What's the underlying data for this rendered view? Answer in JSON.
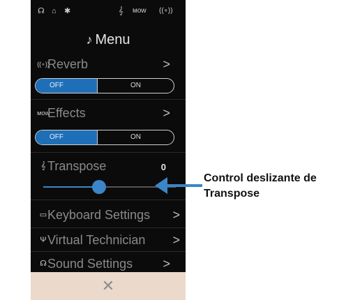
{
  "status_bar": {
    "icons": [
      "headphones-icon",
      "usb-drive-icon",
      "bluetooth-icon",
      "transpose-icon",
      "effects-icon",
      "reverb-icon"
    ],
    "headphones": "☊",
    "usb": "⌂",
    "bluetooth": "✱",
    "transpose": "𝄞",
    "effects": "ᴍᴏᴡ",
    "reverb": "((∘))"
  },
  "menu": {
    "title": "Menu",
    "title_icon": "♪"
  },
  "reverb": {
    "icon": "((∘))",
    "label": "Reverb",
    "chevron": ">",
    "toggle": {
      "off": "OFF",
      "on": "ON",
      "selected": "OFF"
    }
  },
  "effects": {
    "icon": "ᴍᴏᴡ",
    "label": "Effects",
    "chevron": ">",
    "toggle": {
      "off": "OFF",
      "on": "ON",
      "selected": "OFF"
    }
  },
  "transpose": {
    "icon": "𝄞",
    "label": "Transpose",
    "value": "0",
    "slider_position": 0.5
  },
  "items": [
    {
      "icon": "▭",
      "label": "Keyboard Settings",
      "chevron": ">"
    },
    {
      "icon": "Ψ",
      "label": "Virtual Technician",
      "chevron": ">"
    },
    {
      "icon": "☊",
      "label": "Sound Settings",
      "chevron": ">"
    }
  ],
  "close": {
    "icon": "✕"
  },
  "callout": {
    "line1": "Control deslizante de",
    "line2": "Transpose"
  },
  "colors": {
    "accent": "#1f6fb8",
    "background": "#0b0b0b",
    "close_bar": "#ebd9cb",
    "arrow": "#3b86c8"
  }
}
